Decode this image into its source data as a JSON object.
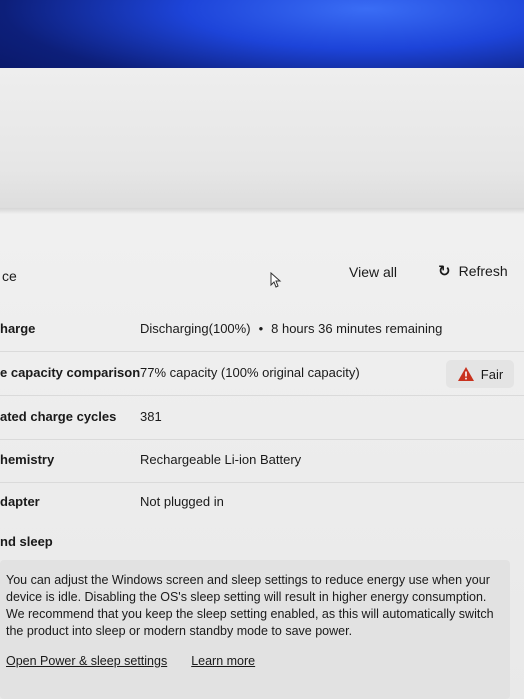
{
  "header": {
    "section_title": "ce",
    "view_all_label": "View all",
    "refresh_label": "Refresh",
    "refresh_icon": "refresh-icon"
  },
  "rows": [
    {
      "label": "harge",
      "value": "Discharging(100%)",
      "extra": "8 hours 36 minutes remaining"
    },
    {
      "label": "e capacity comparison",
      "value": "77% capacity (100% original capacity)",
      "badge": "Fair",
      "badge_icon": "warning-icon"
    },
    {
      "label": "ated charge cycles",
      "value": "381"
    },
    {
      "label": "hemistry",
      "value": "Rechargeable Li-ion Battery"
    },
    {
      "label": "dapter",
      "value": "Not plugged in"
    }
  ],
  "power_sleep": {
    "title": "nd sleep",
    "description": "You can adjust the Windows screen and sleep settings to reduce energy use when your device is idle. Disabling the OS's sleep setting will result in higher energy consumption. We recommend that you keep the sleep setting enabled, as this will automatically switch the product into sleep or modern standby mode to save power.",
    "link_power": "Open Power & sleep settings",
    "link_learn": "Learn more"
  },
  "colors": {
    "warning": "#c8321e",
    "wallpaper": "#1a3fd8"
  }
}
